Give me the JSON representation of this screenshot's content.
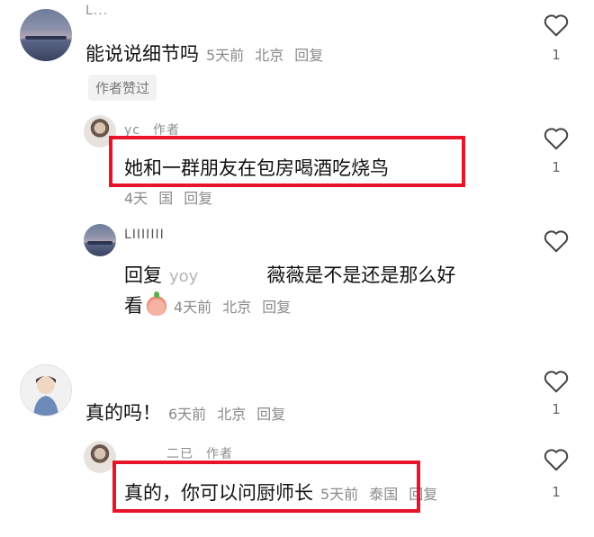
{
  "comments": [
    {
      "name": "L...",
      "text": "能说说细节吗",
      "time": "5天前",
      "location": "北京",
      "reply": "回复",
      "badge": "作者赞过",
      "likes": "1",
      "replies": [
        {
          "name": "yc",
          "author_tag": "作者",
          "text": "她和一群朋友在包房喝酒吃烧鸟",
          "time": "4天",
          "location": "国",
          "reply": "回复",
          "likes": "1"
        },
        {
          "name": "LIIIIIII",
          "prefix": "回复",
          "reply_to": "yoy",
          "text_line1": "薇薇是不是还是那么好",
          "text_line2": "看",
          "time": "4天前",
          "location": "北京",
          "reply": "回复"
        }
      ]
    },
    {
      "name": "",
      "text": "真的吗！",
      "time": "6天前",
      "location": "北京",
      "reply": "回复",
      "likes": "1",
      "replies": [
        {
          "name": "二已",
          "author_tag": "作者",
          "text": "真的，你可以问厨师长",
          "time": "5天前",
          "location": "泰国",
          "reply": "回复",
          "likes": "1"
        }
      ]
    }
  ],
  "colors": {
    "highlight": "#e8142a",
    "meta": "#8a8a8a"
  },
  "icons": {
    "like": "heart-outline-icon",
    "emoji": "peach-emoji-icon"
  }
}
